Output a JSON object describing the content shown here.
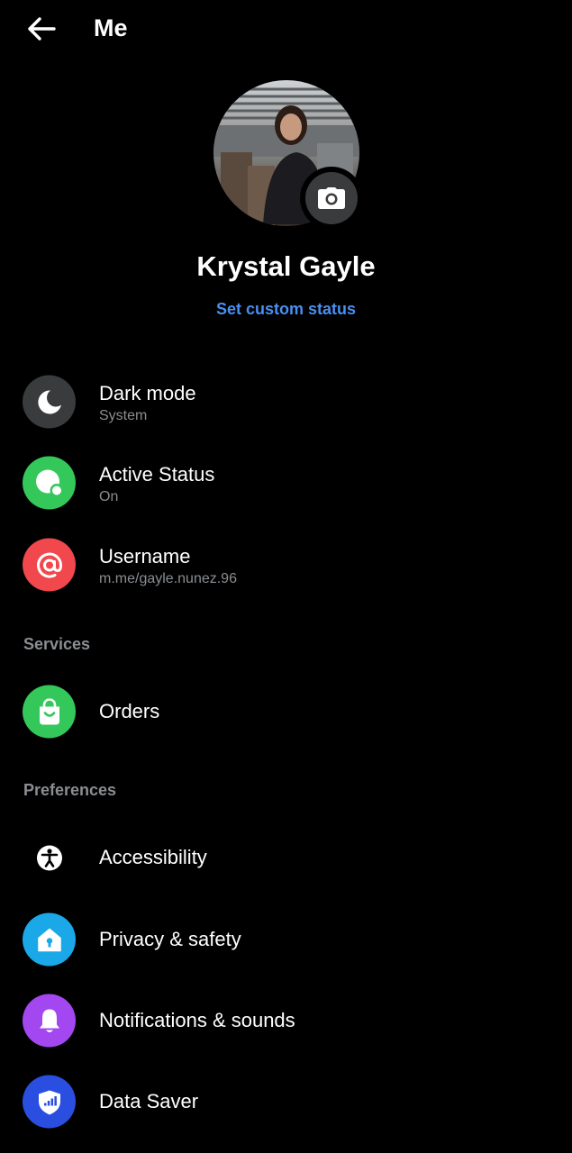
{
  "header": {
    "title": "Me"
  },
  "profile": {
    "name": "Krystal Gayle",
    "custom_status_link": "Set custom status"
  },
  "settings": [
    {
      "label": "Dark mode",
      "sub": "System",
      "icon": "moon-icon",
      "color": "#3a3b3c"
    },
    {
      "label": "Active Status",
      "sub": "On",
      "icon": "active-status-icon",
      "color": "#34c759"
    },
    {
      "label": "Username",
      "sub": "m.me/gayle.nunez.96",
      "icon": "at-sign-icon",
      "color": "#f0484d"
    }
  ],
  "sections": {
    "services": {
      "title": "Services",
      "items": [
        {
          "label": "Orders",
          "icon": "shopping-bag-icon",
          "color": "#34c759"
        }
      ]
    },
    "preferences": {
      "title": "Preferences",
      "items": [
        {
          "label": "Accessibility",
          "icon": "accessibility-icon",
          "color": "#000000"
        },
        {
          "label": "Privacy & safety",
          "icon": "privacy-house-icon",
          "color": "#1aa8e8"
        },
        {
          "label": "Notifications & sounds",
          "icon": "bell-icon",
          "color": "#a347f0"
        },
        {
          "label": "Data Saver",
          "icon": "shield-signal-icon",
          "color": "#2a4fe0"
        }
      ]
    }
  }
}
